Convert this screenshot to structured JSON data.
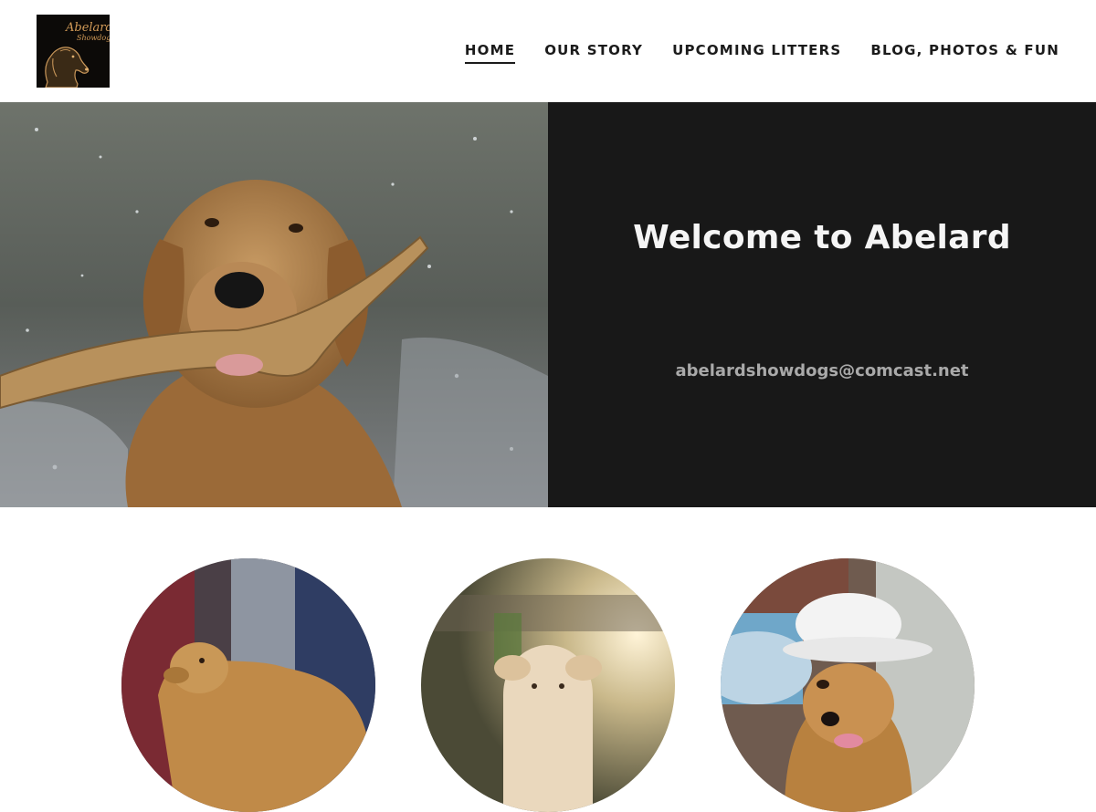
{
  "header": {
    "logo": {
      "title": "Abelard",
      "subtitle": "Showdogs",
      "icon": "golden-retriever-head-icon"
    },
    "nav": [
      {
        "label": "HOME",
        "active": true
      },
      {
        "label": "OUR STORY",
        "active": false
      },
      {
        "label": "UPCOMING LITTERS",
        "active": false
      },
      {
        "label": "BLOG, PHOTOS & FUN",
        "active": false
      }
    ]
  },
  "hero": {
    "title": "Welcome to Abelard",
    "email": "abelardshowdogs@comcast.net",
    "panel_color": "#181818",
    "photo": "wet golden retriever carrying a stick in water"
  },
  "features": {
    "items": [
      {
        "photo": "golden retriever show stack with handler"
      },
      {
        "photo": "fluffy golden retriever puppy in sunlight"
      },
      {
        "photo": "golden retriever wearing a white hat"
      }
    ]
  },
  "colors": {
    "text_dark": "#1b1b1b",
    "hero_title": "#f5f5f5",
    "hero_email": "#a9a9a9"
  }
}
